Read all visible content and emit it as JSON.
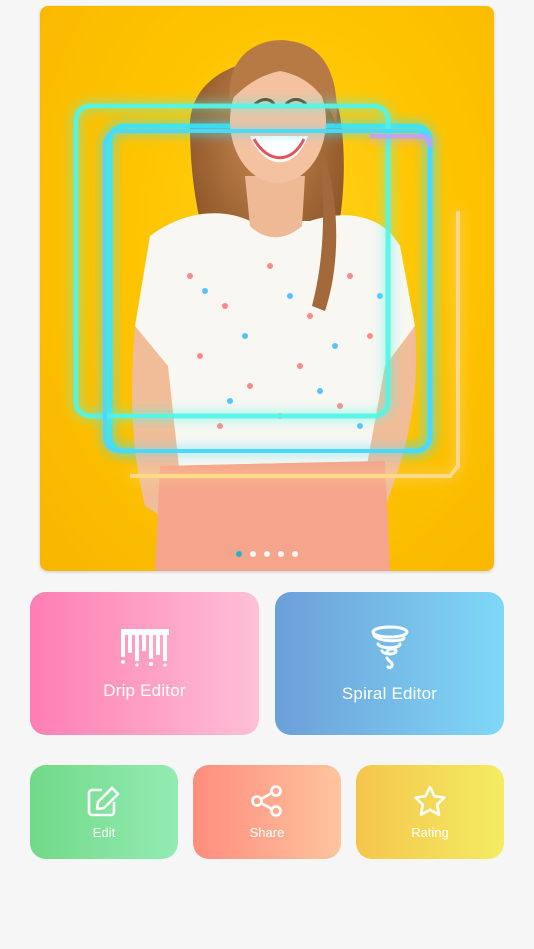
{
  "banner": {
    "slides": 5,
    "active_slide": 1
  },
  "actions": {
    "drip_label": "Drip Editor",
    "spiral_label": "Spiral Editor",
    "edit_label": "Edit",
    "share_label": "Share",
    "rating_label": "Rating"
  },
  "icons": {
    "drip": "drip-icon",
    "spiral": "spiral-icon",
    "edit": "edit-icon",
    "share": "share-icon",
    "rating": "star-icon"
  },
  "colors": {
    "drip_gradient": [
      "#ff7eb3",
      "#ffc0d6"
    ],
    "spiral_gradient": [
      "#6c9fd8",
      "#7fd8f7"
    ],
    "edit_gradient": [
      "#70d987",
      "#93ecb3"
    ],
    "share_gradient": [
      "#ff8d7d",
      "#ffc49d"
    ],
    "rating_gradient": [
      "#f5c54c",
      "#f4ec63"
    ],
    "active_dot": "#1fb6c9"
  }
}
